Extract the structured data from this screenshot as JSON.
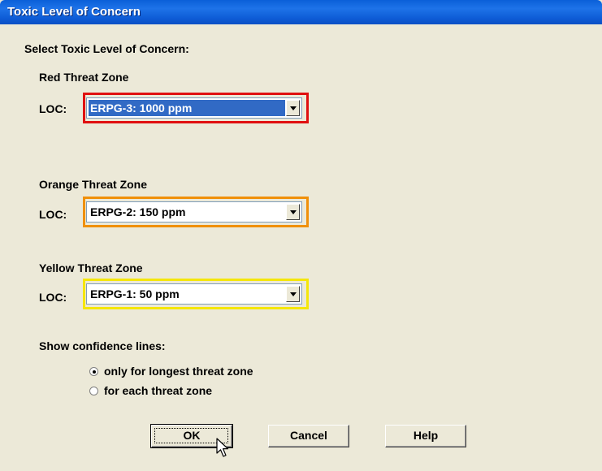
{
  "window": {
    "title": "Toxic Level of Concern"
  },
  "heading": "Select Toxic Level of Concern:",
  "zones": [
    {
      "title": "Red Threat Zone",
      "loc_label": "LOC:",
      "value": "ERPG-3: 1000 ppm",
      "color": "#E01010"
    },
    {
      "title": "Orange Threat Zone",
      "loc_label": "LOC:",
      "value": "ERPG-2: 150 ppm",
      "color": "#F0900A"
    },
    {
      "title": "Yellow Threat Zone",
      "loc_label": "LOC:",
      "value": "ERPG-1: 50 ppm",
      "color": "#F5E60A"
    }
  ],
  "confidence": {
    "label": "Show confidence lines:",
    "options": [
      {
        "label": "only for longest threat zone",
        "selected": true
      },
      {
        "label": "for each threat zone",
        "selected": false
      }
    ]
  },
  "buttons": {
    "ok": "OK",
    "cancel": "Cancel",
    "help": "Help"
  },
  "colors": {
    "titlebar": "#0A5FD8",
    "face": "#ECE9D8",
    "selection": "#316AC5"
  }
}
